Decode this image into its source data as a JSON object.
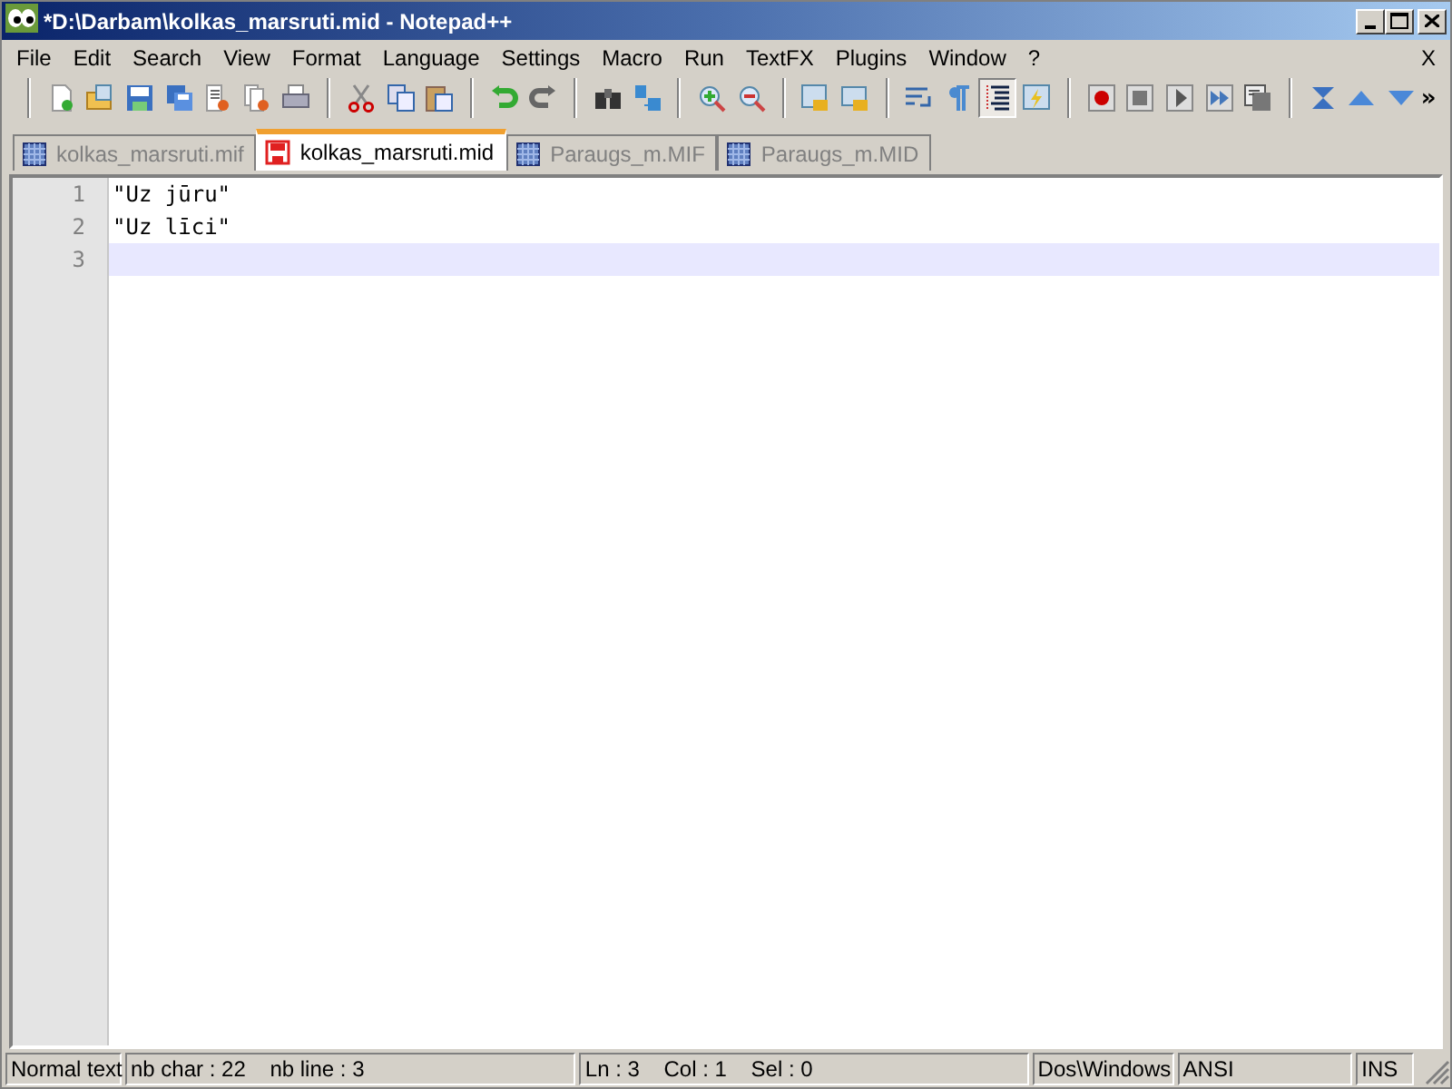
{
  "window": {
    "title": "*D:\\Darbam\\kolkas_marsruti.mid - Notepad++"
  },
  "menu": {
    "items": [
      "File",
      "Edit",
      "Search",
      "View",
      "Format",
      "Language",
      "Settings",
      "Macro",
      "Run",
      "TextFX",
      "Plugins",
      "Window",
      "?"
    ],
    "close_label": "X"
  },
  "toolbar": {
    "items": [
      {
        "kind": "button",
        "pressed": false
      },
      {
        "kind": "button",
        "pressed": false
      },
      {
        "kind": "button",
        "pressed": false
      },
      {
        "kind": "button",
        "pressed": false
      },
      {
        "kind": "button",
        "pressed": false
      },
      {
        "kind": "button",
        "pressed": false
      },
      {
        "kind": "button",
        "pressed": false
      },
      {
        "kind": "separator"
      },
      {
        "kind": "button",
        "pressed": false
      },
      {
        "kind": "button",
        "pressed": false
      },
      {
        "kind": "button",
        "pressed": false
      },
      {
        "kind": "separator"
      },
      {
        "kind": "button",
        "pressed": false
      },
      {
        "kind": "button",
        "pressed": false
      },
      {
        "kind": "separator"
      },
      {
        "kind": "button",
        "pressed": false
      },
      {
        "kind": "button",
        "pressed": false
      },
      {
        "kind": "separator"
      },
      {
        "kind": "button",
        "pressed": false
      },
      {
        "kind": "button",
        "pressed": false
      },
      {
        "kind": "separator"
      },
      {
        "kind": "button",
        "pressed": false
      },
      {
        "kind": "button",
        "pressed": false
      },
      {
        "kind": "separator"
      },
      {
        "kind": "button",
        "pressed": false
      },
      {
        "kind": "button",
        "pressed": false
      },
      {
        "kind": "button",
        "pressed": true
      },
      {
        "kind": "button",
        "pressed": false
      },
      {
        "kind": "separator"
      },
      {
        "kind": "button",
        "pressed": false
      },
      {
        "kind": "button",
        "pressed": false
      },
      {
        "kind": "button",
        "pressed": false
      },
      {
        "kind": "button",
        "pressed": false
      },
      {
        "kind": "button",
        "pressed": false
      },
      {
        "kind": "separator"
      },
      {
        "kind": "button",
        "pressed": false
      },
      {
        "kind": "button",
        "pressed": false
      },
      {
        "kind": "button",
        "pressed": false
      }
    ],
    "overflow": "»"
  },
  "tabs": [
    {
      "label": "kolkas_marsruti.mif",
      "selected": false,
      "modified": false
    },
    {
      "label": "kolkas_marsruti.mid",
      "selected": true,
      "modified": true
    },
    {
      "label": "Paraugs_m.MIF",
      "selected": false,
      "modified": false
    },
    {
      "label": "Paraugs_m.MID",
      "selected": false,
      "modified": false
    }
  ],
  "editor": {
    "lines": [
      {
        "number": "1",
        "text": "\"Uz jūru\"",
        "current": false
      },
      {
        "number": "2",
        "text": "\"Uz līci\"",
        "current": false
      },
      {
        "number": "3",
        "current": true
      }
    ]
  },
  "status_bar": [
    "Normal text",
    "nb char : 22    nb line : 3",
    "Ln : 3    Col : 1    Sel : 0",
    "Dos\\Windows",
    "ANSI",
    "INS"
  ]
}
